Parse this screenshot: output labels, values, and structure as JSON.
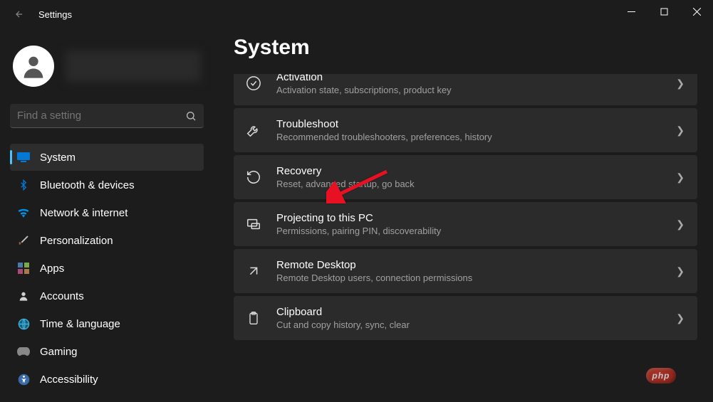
{
  "window": {
    "title": "Settings"
  },
  "search": {
    "placeholder": "Find a setting"
  },
  "sidebar": {
    "items": [
      {
        "label": "System"
      },
      {
        "label": "Bluetooth & devices"
      },
      {
        "label": "Network & internet"
      },
      {
        "label": "Personalization"
      },
      {
        "label": "Apps"
      },
      {
        "label": "Accounts"
      },
      {
        "label": "Time & language"
      },
      {
        "label": "Gaming"
      },
      {
        "label": "Accessibility"
      }
    ]
  },
  "main": {
    "title": "System",
    "cards": [
      {
        "title": "Activation",
        "desc": "Activation state, subscriptions, product key"
      },
      {
        "title": "Troubleshoot",
        "desc": "Recommended troubleshooters, preferences, history"
      },
      {
        "title": "Recovery",
        "desc": "Reset, advanced startup, go back"
      },
      {
        "title": "Projecting to this PC",
        "desc": "Permissions, pairing PIN, discoverability"
      },
      {
        "title": "Remote Desktop",
        "desc": "Remote Desktop users, connection permissions"
      },
      {
        "title": "Clipboard",
        "desc": "Cut and copy history, sync, clear"
      }
    ]
  },
  "badge": {
    "text": "php"
  }
}
